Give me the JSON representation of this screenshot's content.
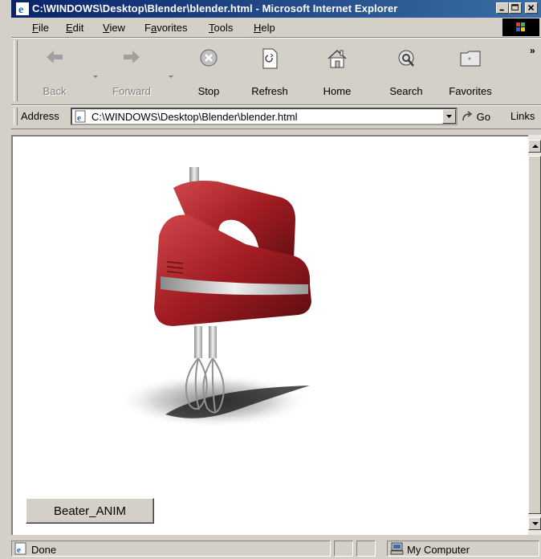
{
  "window": {
    "title": "C:\\WINDOWS\\Desktop\\Blender\\blender.html - Microsoft Internet Explorer"
  },
  "menu": {
    "items": [
      {
        "accel": "F",
        "rest": "ile"
      },
      {
        "accel": "E",
        "rest": "dit"
      },
      {
        "accel": "V",
        "rest": "iew"
      },
      {
        "pre": "F",
        "accel": "a",
        "rest": "vorites"
      },
      {
        "accel": "T",
        "rest": "ools"
      },
      {
        "accel": "H",
        "rest": "elp"
      }
    ]
  },
  "toolbar": {
    "back": "Back",
    "forward": "Forward",
    "stop": "Stop",
    "refresh": "Refresh",
    "home": "Home",
    "search": "Search",
    "favorites": "Favorites",
    "more": "»"
  },
  "address": {
    "label": "Address",
    "url": "C:\\WINDOWS\\Desktop\\Blender\\blender.html",
    "go": "Go",
    "links": "Links"
  },
  "content": {
    "button_label": "Beater_ANIM"
  },
  "status": {
    "text": "Done",
    "zone": "My Computer"
  },
  "colors": {
    "titlebar_start": "#0a246a",
    "titlebar_end": "#3a6ea5",
    "chrome": "#d4d0c8",
    "mixer_red": "#a01c22"
  }
}
